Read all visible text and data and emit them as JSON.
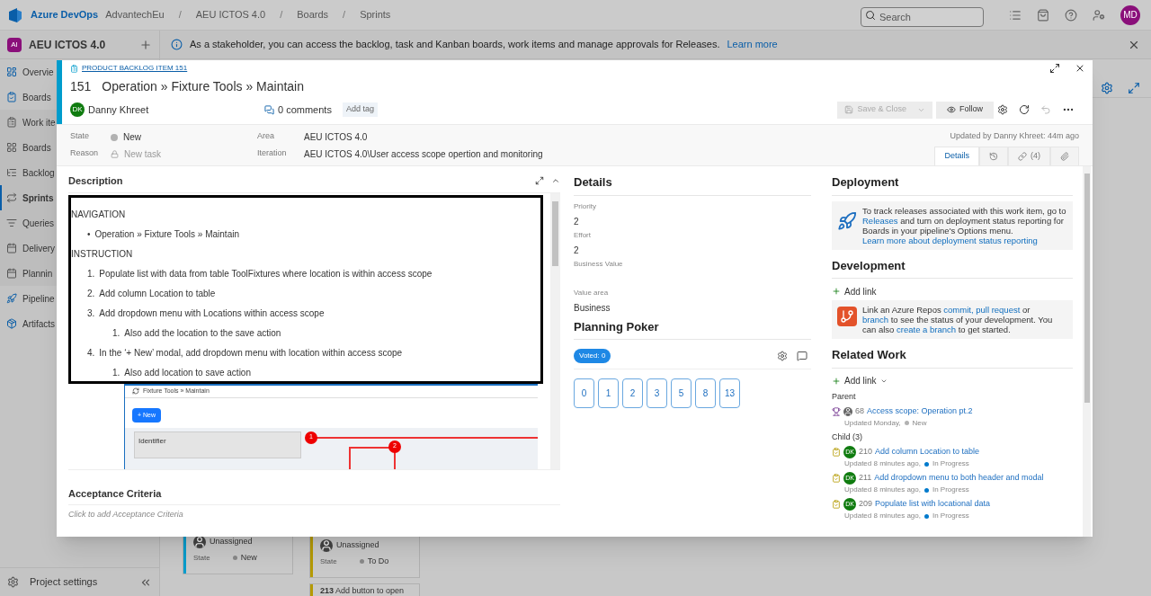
{
  "top_bar": {
    "brand": "Azure DevOps",
    "separator": "/",
    "breadcrumbs": [
      "AdvantechEu",
      "AEU ICTOS 4.0",
      "Boards",
      "Sprints"
    ],
    "search": {
      "placeholder": "Search"
    },
    "avatar": "MD"
  },
  "sidebar": {
    "project": {
      "badge": "AI",
      "name": "AEU ICTOS 4.0"
    },
    "items": [
      {
        "label": "Overvie",
        "kind": "hub",
        "selected": false
      },
      {
        "label": "Boards",
        "kind": "hub",
        "selected": false
      },
      {
        "label": "Work ite",
        "kind": "sub",
        "selected": false
      },
      {
        "label": "Boards",
        "kind": "sub",
        "selected": false
      },
      {
        "label": "Backlog",
        "kind": "sub",
        "selected": false
      },
      {
        "label": "Sprints",
        "kind": "sub",
        "selected": true
      },
      {
        "label": "Queries",
        "kind": "sub",
        "selected": false
      },
      {
        "label": "Delivery",
        "kind": "sub",
        "selected": false
      },
      {
        "label": "Plannin",
        "kind": "sub",
        "selected": false
      },
      {
        "label": "Pipeline",
        "kind": "hub",
        "selected": false
      },
      {
        "label": "Artifacts",
        "kind": "hub",
        "selected": false
      }
    ],
    "footer": "Project settings"
  },
  "banner": {
    "text": "As a stakeholder, you can access the backlog, task and Kanban boards, work items and manage approvals for Releases.",
    "link": "Learn more"
  },
  "board_cards": [
    {
      "assignee": "Unassigned",
      "state_label": "State",
      "state": "New",
      "color": "#009ccc"
    },
    {
      "assignee": "Unassigned",
      "state_label": "State",
      "state": "To Do",
      "color": "#b59a00"
    }
  ],
  "partial_card": {
    "id": "213",
    "title": "Add button to open",
    "color": "#b59a00"
  },
  "work_item": {
    "type": "PRODUCT BACKLOG ITEM 151",
    "id": "151",
    "title": "Operation » Fixture Tools » Maintain",
    "assignee": {
      "initials": "DK",
      "name": "Danny Khreet"
    },
    "comments": "0 comments",
    "add_tag": "Add tag",
    "save": {
      "label": "Save & Close",
      "disabled": true
    },
    "follow": "Follow",
    "fields": [
      {
        "label": "State",
        "value": "New",
        "kind": "state"
      },
      {
        "label": "Reason",
        "value": "New task",
        "kind": "locked"
      },
      {
        "label": "Area",
        "value": "AEU ICTOS 4.0"
      },
      {
        "label": "Iteration",
        "value": "AEU ICTOS 4.0\\User access scope opertion and monitoring"
      }
    ],
    "updated": "Updated by Danny Khreet: 44m ago",
    "tabs": [
      {
        "kind": "details",
        "label": "Details",
        "selected": true
      },
      {
        "kind": "history",
        "selected": false
      },
      {
        "kind": "links",
        "label": "(4)",
        "selected": false
      },
      {
        "kind": "attachments",
        "selected": false
      }
    ],
    "description": {
      "heading": "Description",
      "blocks": [
        {
          "kind": "heading",
          "text": "NAVIGATION"
        },
        {
          "kind": "bullet",
          "marker": "•",
          "text": "Operation » Fixture Tools » Maintain"
        },
        {
          "kind": "heading",
          "text": "INSTRUCTION"
        },
        {
          "kind": "numbered",
          "marker": "1.",
          "text": "Populate list with data from table ToolFixtures where location is within access scope"
        },
        {
          "kind": "numbered",
          "marker": "2.",
          "text": "Add column Location to table"
        },
        {
          "kind": "numbered",
          "marker": "3.",
          "text": "Add dropdown menu with Locations within access scope"
        },
        {
          "kind": "sub",
          "marker": "1.",
          "text": "Also add the location to the save action"
        },
        {
          "kind": "numbered",
          "marker": "4.",
          "text": "In the ‘+ New’ modal, add dropdown menu with location within access scope"
        },
        {
          "kind": "sub",
          "marker": "1.",
          "text": "Also add location to save action"
        }
      ],
      "screenshot": {
        "title": "Fixture Tools » Maintain",
        "new_button": "+ New",
        "filter_label": "Identifier",
        "markers": [
          "1",
          "2"
        ]
      }
    }
  },
  "acceptance": {
    "heading": "Acceptance Criteria",
    "placeholder": "Click to add Acceptance Criteria"
  },
  "details": {
    "heading": "Details",
    "fields": [
      {
        "label": "Priority",
        "value": "2"
      },
      {
        "label": "Effort",
        "value": "2"
      },
      {
        "label": "Business Value"
      },
      {
        "label": "Value area",
        "value": "Business"
      }
    ]
  },
  "planning_poker": {
    "heading": "Planning Poker",
    "voted": "Voted: 0",
    "cards": [
      "0",
      "1",
      "2",
      "3",
      "5",
      "8",
      "13"
    ]
  },
  "deployment": {
    "heading": "Deployment",
    "segments": [
      {
        "text": "To track releases associated with this work item, go to"
      },
      {
        "text": "Releases",
        "link": true
      },
      {
        "text": "and turn on deployment status reporting for Boards in your pipeline's Options menu."
      },
      {
        "text": "Learn more about deployment status reporting",
        "link": true
      }
    ]
  },
  "development": {
    "heading": "Development",
    "add_link": "Add link",
    "segments": [
      {
        "text": "Link an Azure Repos"
      },
      {
        "text": "commit,",
        "link": true
      },
      {
        "text": "pull request",
        "link": true
      },
      {
        "text": "or"
      },
      {
        "text": "branch",
        "link": true
      },
      {
        "text": "to see the status of your development. You can also"
      },
      {
        "text": "create a branch",
        "link": true
      },
      {
        "text": "to get started."
      }
    ]
  },
  "related_work": {
    "heading": "Related Work",
    "add_link": "Add link",
    "groups": [
      {
        "label": "Parent",
        "items": [
          {
            "kind": "feature",
            "id": "68",
            "title": "Access scope: Operation pt.2",
            "updated": "Updated Monday,",
            "state": "New",
            "color": "#b2b2b2"
          }
        ]
      },
      {
        "label": "Child (3)",
        "items": [
          {
            "kind": "task",
            "avatar": "DK",
            "id": "210",
            "title": "Add column Location to table",
            "updated": "Updated 8 minutes ago,",
            "state": "In Progress",
            "color": "#007acc"
          },
          {
            "kind": "task",
            "avatar": "DK",
            "id": "211",
            "title": "Add dropdown menu to both header and modal",
            "updated": "Updated 8 minutes ago,",
            "state": "In Progress",
            "color": "#007acc"
          },
          {
            "kind": "task",
            "avatar": "DK",
            "id": "209",
            "title": "Populate list with locational data",
            "updated": "Updated 8 minutes ago,",
            "state": "In Progress",
            "color": "#007acc"
          }
        ]
      }
    ]
  }
}
